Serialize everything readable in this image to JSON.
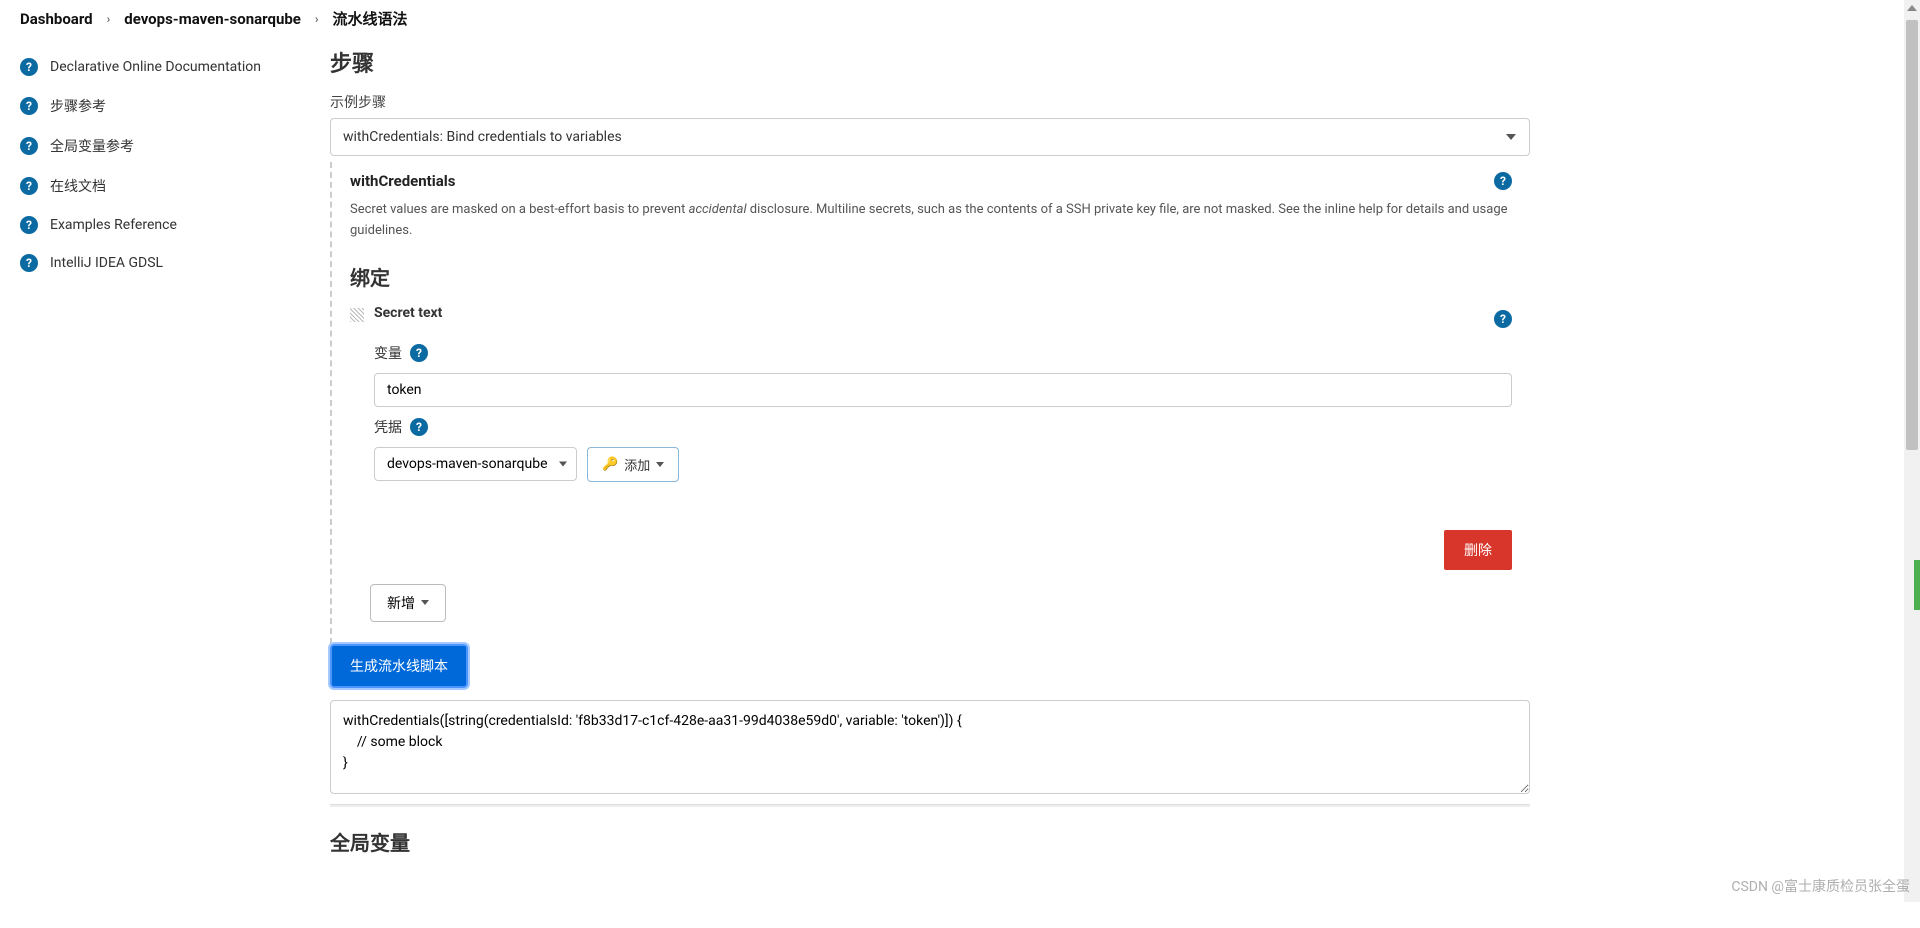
{
  "breadcrumb": {
    "dashboard": "Dashboard",
    "project": "devops-maven-sonarqube",
    "page": "流水线语法"
  },
  "sidebar": {
    "items": [
      {
        "label": "Declarative Online Documentation"
      },
      {
        "label": "步骤参考"
      },
      {
        "label": "全局变量参考"
      },
      {
        "label": "在线文档"
      },
      {
        "label": "Examples Reference"
      },
      {
        "label": "IntelliJ IDEA GDSL"
      }
    ]
  },
  "main": {
    "steps_heading": "步骤",
    "sample_step_label": "示例步骤",
    "select_value": "withCredentials: Bind credentials to variables",
    "step_name": "withCredentials",
    "desc_pre": "Secret values are masked on a best-effort basis to prevent ",
    "desc_em": "accidental",
    "desc_post": " disclosure. Multiline secrets, such as the contents of a SSH private key file, are not masked. See the inline help for details and usage guidelines.",
    "bindings_heading": "绑定",
    "binding": {
      "type_label": "Secret text",
      "var_label": "变量",
      "var_value": "token",
      "cred_label": "凭据",
      "cred_selected": "devops-maven-sonarqube",
      "add_label": "添加"
    },
    "delete_label": "删除",
    "new_label": "新增",
    "generate_label": "生成流水线脚本",
    "output": "withCredentials([string(credentialsId: 'f8b33d17-c1cf-428e-aa31-99d4038e59d0', variable: 'token')]) {\n    // some block\n}",
    "globals_heading": "全局变量"
  },
  "watermark": "CSDN @富士康质检员张全蛋"
}
